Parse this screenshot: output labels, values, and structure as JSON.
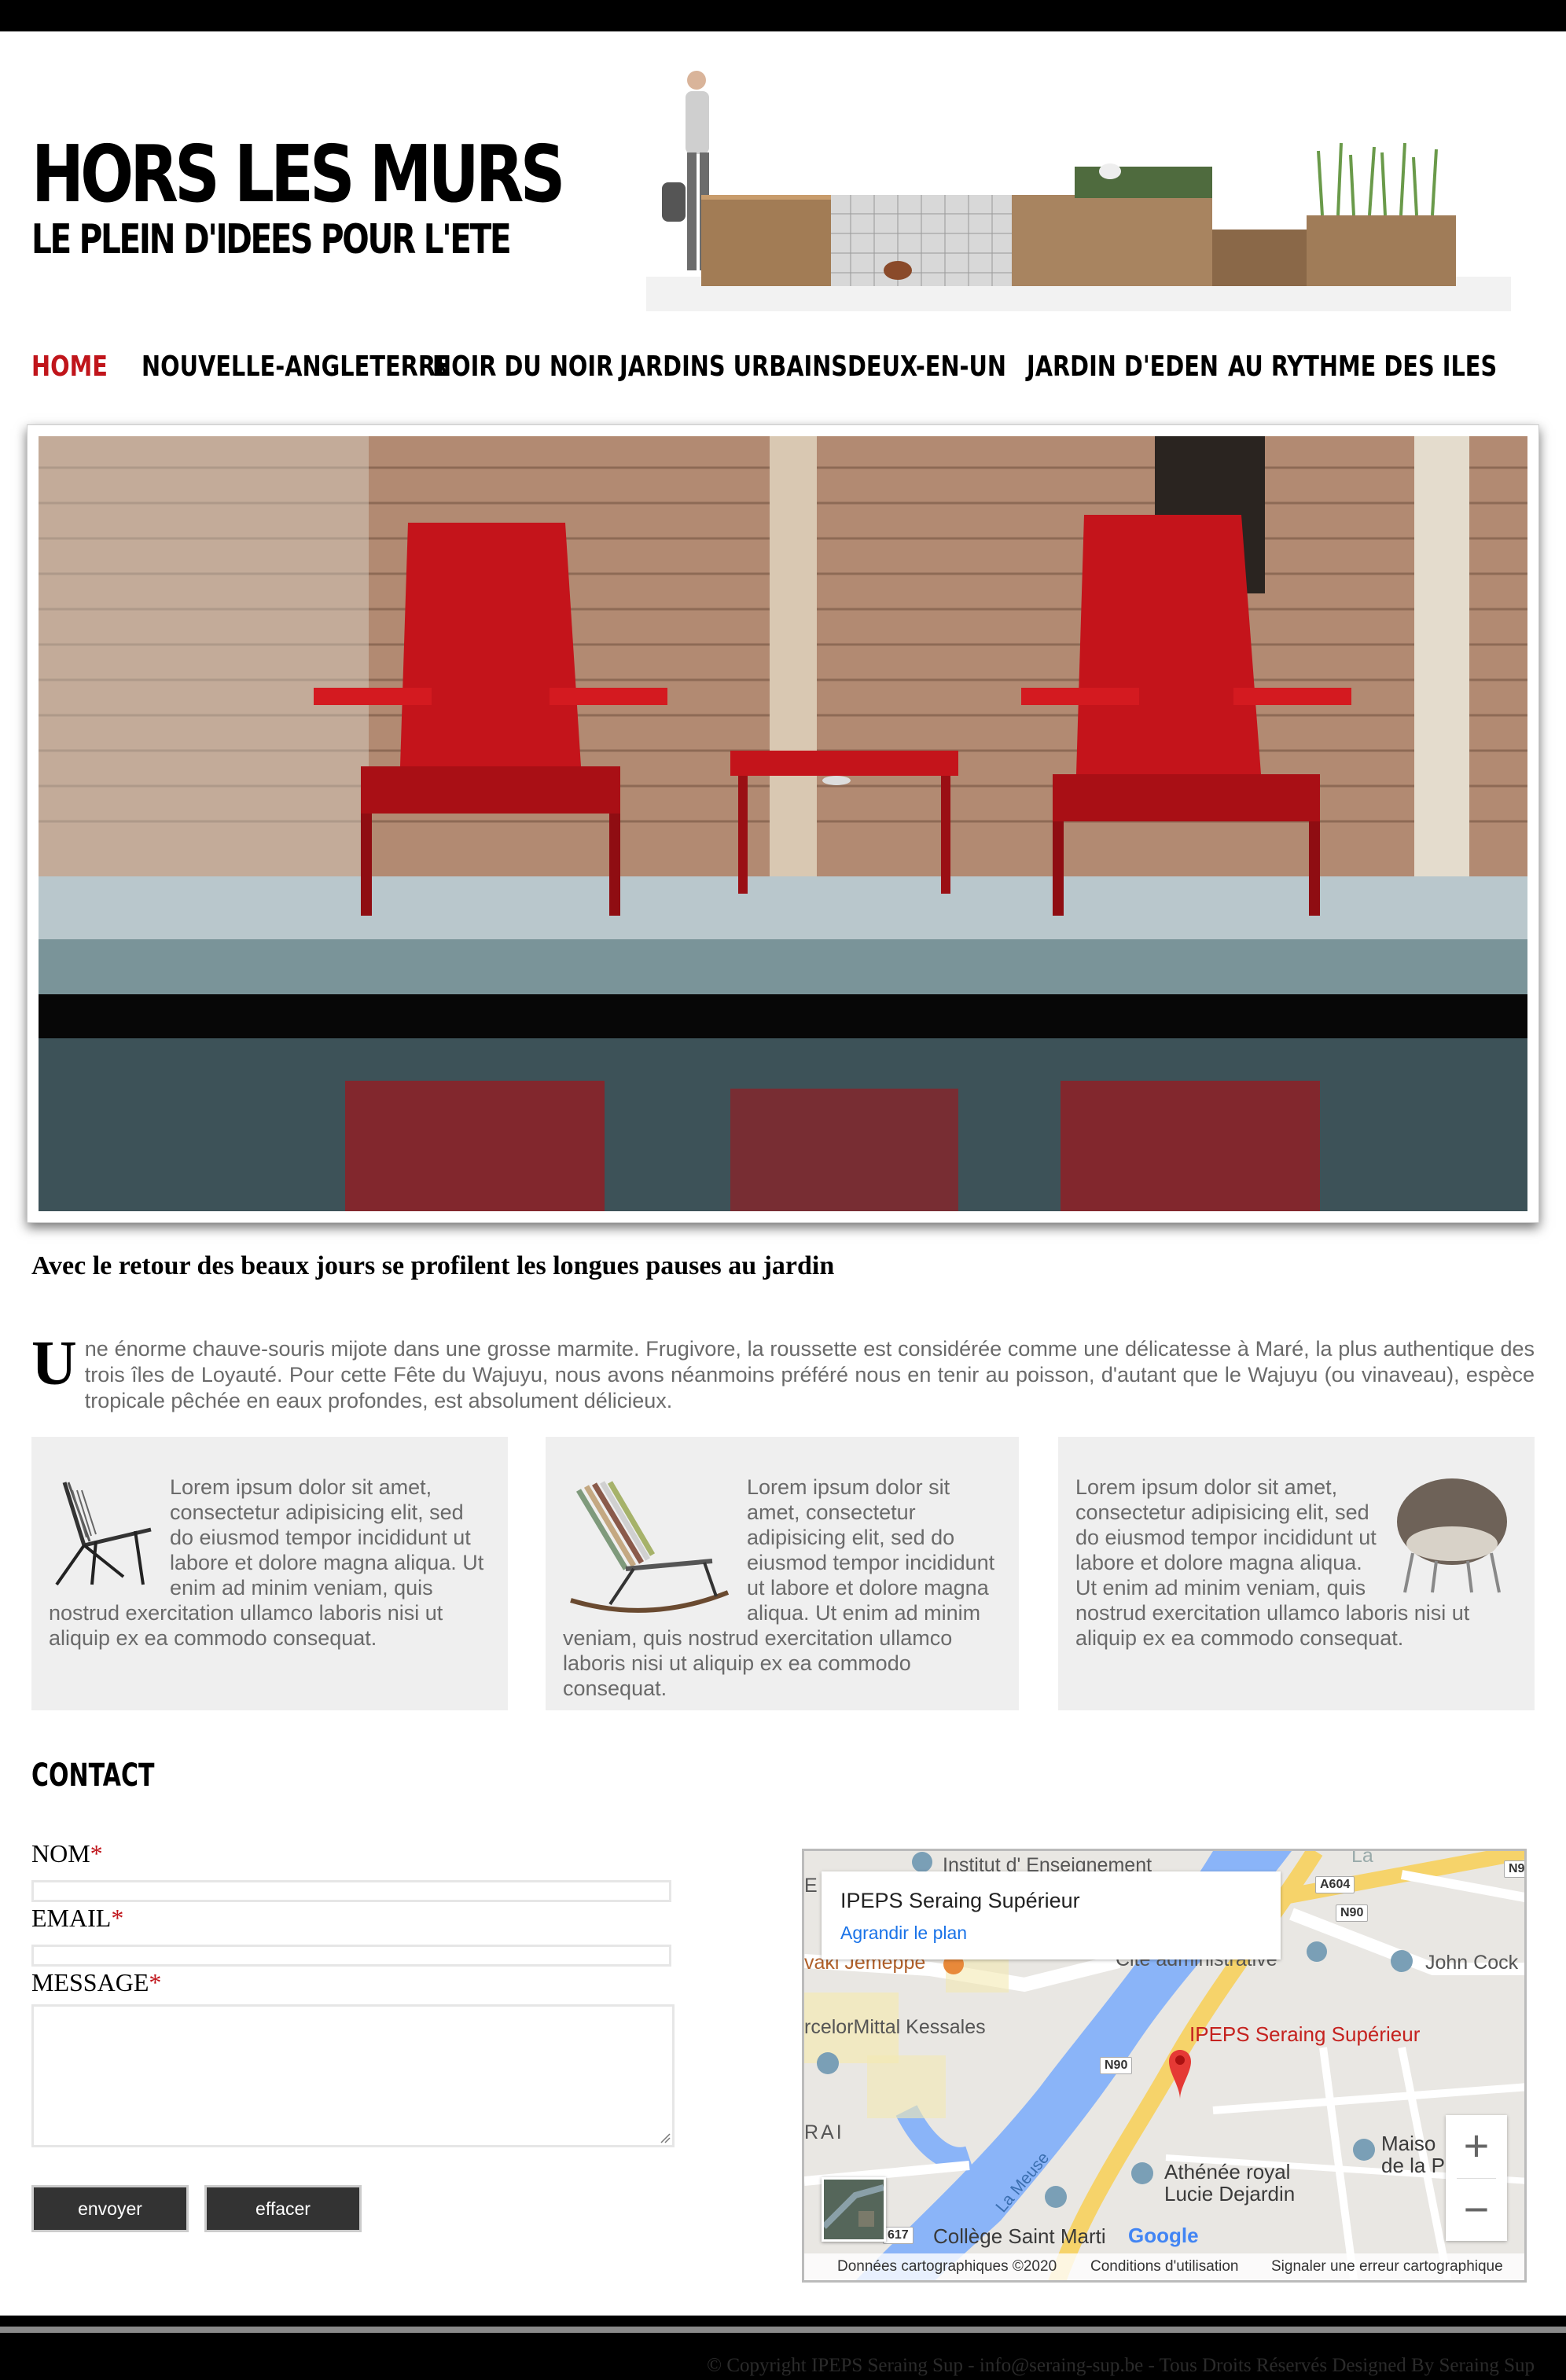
{
  "header": {
    "title": "HORS LES MURS",
    "subtitle": "LE PLEIN D'IDEES POUR L'ETE"
  },
  "nav": {
    "items": [
      {
        "label": "HOME",
        "active": true
      },
      {
        "label": "NOUVELLE-ANGLETERRE",
        "active": false
      },
      {
        "label": "NOIR DU NOIR",
        "active": false
      },
      {
        "label": "JARDINS URBAINS",
        "active": false
      },
      {
        "label": "DEUX-EN-UN",
        "active": false
      },
      {
        "label": "JARDIN D'EDEN",
        "active": false
      },
      {
        "label": "AU RYTHME DES ILES",
        "active": false
      }
    ],
    "active_color": "#c0151b"
  },
  "article": {
    "headline": "Avec le retour des beaux jours se profilent les longues pauses au jardin",
    "dropcap": "U",
    "intro": "ne énorme chauve-souris mijote dans une grosse marmite. Frugivore, la roussette est considérée comme une délicatesse à Maré, la plus authentique des trois îles de Loyauté. Pour cette Fête du Wajuyu, nous avons néanmoins préféré nous en tenir au poisson, d'autant que le Wajuyu (ou vinaveau), espèce tropicale pêchée en eaux profondes, est absolument délicieux."
  },
  "cards": [
    {
      "text": "Lorem ipsum dolor sit amet, consectetur adipisicing elit, sed do eiusmod tempor incididunt ut labore et dolore magna aliqua. Ut enim ad minim veniam, quis nostrud exercitation ullamco laboris nisi ut aliquip ex ea commodo consequat.",
      "icon": "chair-icon"
    },
    {
      "text": "Lorem ipsum dolor sit amet, consectetur adipisicing elit, sed do eiusmod tempor incididunt ut labore et dolore magna aliqua. Ut enim ad minim veniam, quis nostrud exercitation ullamco laboris nisi ut aliquip ex ea commodo consequat.",
      "icon": "rocking-chair-icon"
    },
    {
      "text": "Lorem ipsum dolor sit amet, consectetur adipisicing elit, sed do eiusmod tempor incididunt ut labore et dolore magna aliqua. Ut enim ad minim veniam, quis nostrud exercitation ullamco laboris nisi ut aliquip ex ea commodo consequat.",
      "icon": "egg-chair-icon"
    }
  ],
  "contact": {
    "title": "CONTACT",
    "fields": {
      "nom": {
        "label": "NOM",
        "value": ""
      },
      "email": {
        "label": "EMAIL",
        "value": ""
      },
      "message": {
        "label": "MESSAGE",
        "value": ""
      }
    },
    "required_mark": "*",
    "buttons": {
      "send": "envoyer",
      "clear": "effacer"
    }
  },
  "map": {
    "place_title": "IPEPS Seraing Supérieur",
    "enlarge_link": "Agrandir le plan",
    "pin_label": "IPEPS Seraing Supérieur",
    "labels": {
      "institut": "Institut d' Enseignement",
      "jemeppe": "vaki Jemeppe",
      "cite": "Cité administrative",
      "john": "John Cock",
      "arcelor": "rcelorMittal Kessales",
      "rai": "RAI",
      "maison_1": "Maiso",
      "maison_2": "de la P",
      "athenee_1": "Athénée royal",
      "athenee_2": "Lucie Dejardin",
      "meuse": "La Meuse",
      "college": "Collège Saint Marti",
      "la": "La",
      "e": "E"
    },
    "roads": {
      "a604": "A604",
      "n90_a": "N90",
      "n90_b": "N90",
      "n90_c": "N90",
      "n9": "N9",
      "r617": "617"
    },
    "zoom_in": "+",
    "zoom_out": "−",
    "google": "Google",
    "footer": {
      "data": "Données cartographiques ©2020",
      "terms": "Conditions d'utilisation",
      "report": "Signaler une erreur cartographique"
    },
    "pin_color": "#e53935"
  },
  "footer": {
    "copyright": "© Copyright IPEPS Seraing Sup - info@seraing-sup.be - Tous Droits Réservés Designed By Seraing Sup"
  }
}
